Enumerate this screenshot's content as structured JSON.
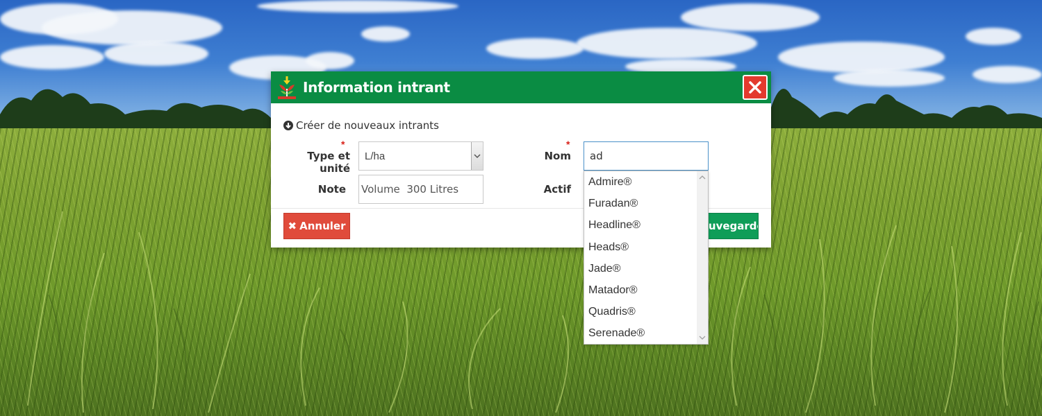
{
  "modal": {
    "title": "Information intrant",
    "close_icon": "close-icon",
    "section_heading": "Créer de nouveaux intrants",
    "fields": {
      "type_unit_label": "Type et unité",
      "type_unit_value": "L/ha",
      "name_label": "Nom",
      "name_value": "ad",
      "note_label": "Note",
      "note_value": "Volume  300 Litres",
      "active_label": "Actif"
    },
    "buttons": {
      "cancel_label": "Annuler",
      "save_label": "Sauvegarder"
    }
  },
  "autocomplete": {
    "options": [
      "Admire®",
      "Furadan®",
      "Headline®",
      "Heads®",
      "Jade®",
      "Matador®",
      "Quadris®",
      "Serenade®"
    ]
  },
  "colors": {
    "header": "#0a8c43",
    "close": "#e33a2e",
    "cancel": "#e04b3b",
    "save": "#0f9d58",
    "required": "#d9221a"
  }
}
